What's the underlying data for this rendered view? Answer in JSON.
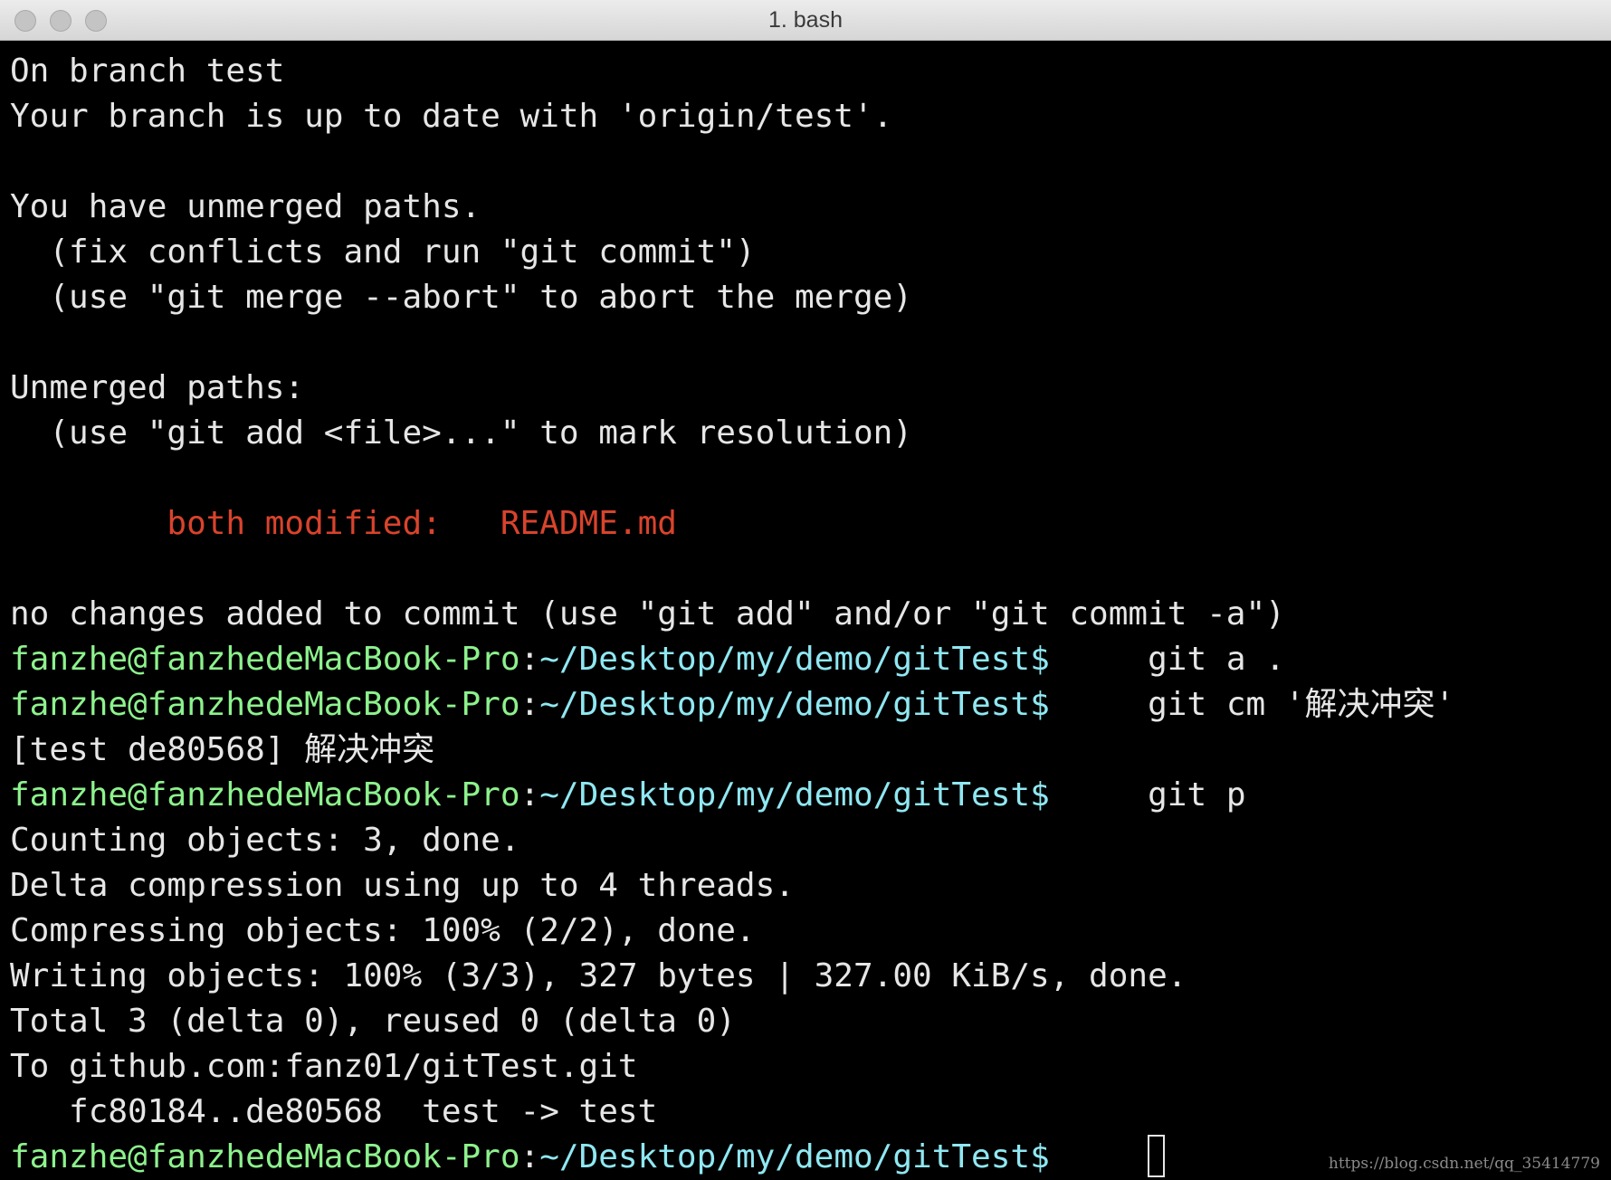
{
  "window": {
    "title": "1. bash"
  },
  "terminal": {
    "status": [
      "On branch test",
      "Your branch is up to date with 'origin/test'.",
      "",
      "You have unmerged paths.",
      "  (fix conflicts and run \"git commit\")",
      "  (use \"git merge --abort\" to abort the merge)",
      "",
      "Unmerged paths:",
      "  (use \"git add <file>...\" to mark resolution)",
      ""
    ],
    "conflict": {
      "indent": "        ",
      "label": "both modified:   ",
      "file": "README.md"
    },
    "after_conflict": [
      "",
      "no changes added to commit (use \"git add\" and/or \"git commit -a\")"
    ],
    "prompt": {
      "user": "fanzhe@fanzhedeMacBook-Pro",
      "colon": ":",
      "path": "~/Desktop/my/demo/gitTest$"
    },
    "cmd1": "     git a .",
    "cmd2": "     git cm '解决冲突'",
    "commit_output": "[test de80568] 解决冲突",
    "cmd3": "     git p",
    "push_output": [
      "Counting objects: 3, done.",
      "Delta compression using up to 4 threads.",
      "Compressing objects: 100% (2/2), done.",
      "Writing objects: 100% (3/3), 327 bytes | 327.00 KiB/s, done.",
      "Total 3 (delta 0), reused 0 (delta 0)",
      "To github.com:fanz01/gitTest.git",
      "   fc80184..de80568  test -> test"
    ],
    "final_spacing": "     "
  },
  "watermark": "https://blog.csdn.net/qq_35414779",
  "colors": {
    "prompt_user": "#8df28d",
    "prompt_path": "#8fe8f2",
    "conflict": "#d9432c",
    "text": "#e6e6e6"
  }
}
